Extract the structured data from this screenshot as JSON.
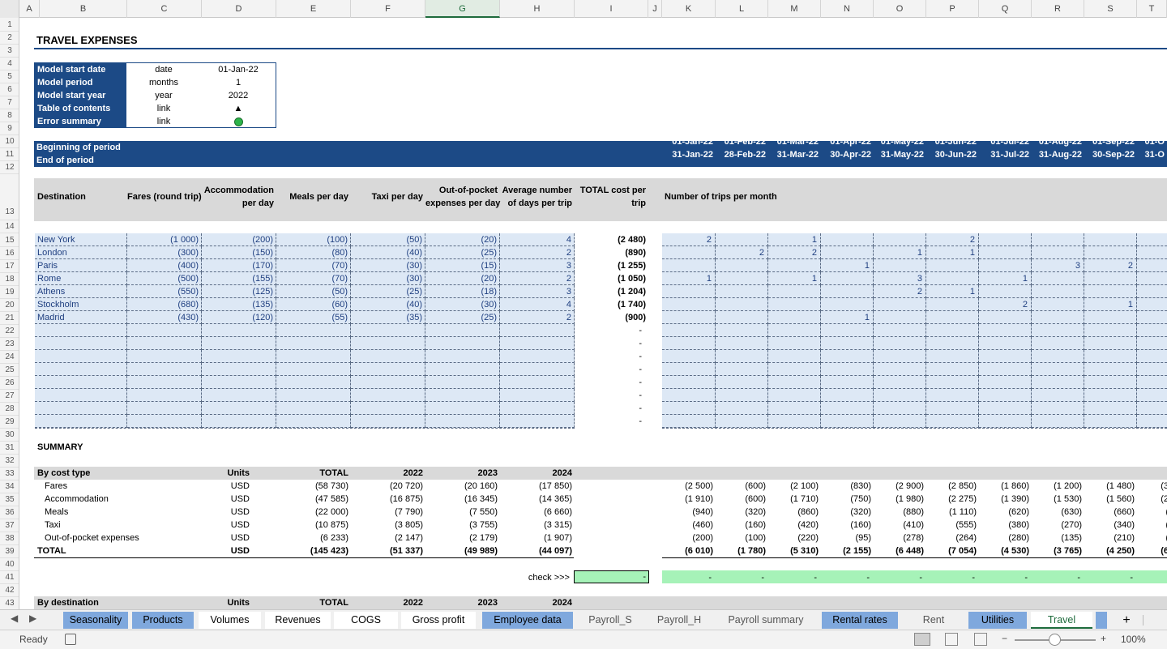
{
  "columns": [
    "A",
    "B",
    "C",
    "D",
    "E",
    "F",
    "G",
    "H",
    "I",
    "J",
    "K",
    "L",
    "M",
    "N",
    "O",
    "P",
    "Q",
    "R",
    "S",
    "T"
  ],
  "selected_column": "G",
  "rows": [
    "1",
    "2",
    "3",
    "4",
    "5",
    "6",
    "7",
    "8",
    "9",
    "10",
    "11",
    "12",
    "13",
    "14",
    "15",
    "16",
    "17",
    "18",
    "19",
    "20",
    "21",
    "22",
    "23",
    "24",
    "25",
    "26",
    "27",
    "28",
    "29",
    "30",
    "31",
    "32",
    "33",
    "34",
    "35",
    "36",
    "37",
    "38",
    "39",
    "40",
    "41",
    "42",
    "43"
  ],
  "title": "TRAVEL EXPENSES",
  "info": [
    {
      "label": "Model start date",
      "unit": "date",
      "value": "01-Jan-22"
    },
    {
      "label": "Model period",
      "unit": "months",
      "value": "1"
    },
    {
      "label": "Model start year",
      "unit": "year",
      "value": "2022"
    },
    {
      "label": "Table of contents",
      "unit": "link",
      "value": "▲"
    },
    {
      "label": "Error summary check",
      "unit": "link",
      "value": "●"
    }
  ],
  "period": {
    "begin_label": "Beginning of period",
    "end_label": "End of period",
    "begin": [
      "01-Jan-22",
      "01-Feb-22",
      "01-Mar-22",
      "01-Apr-22",
      "01-May-22",
      "01-Jun-22",
      "01-Jul-22",
      "01-Aug-22",
      "01-Sep-22",
      "01-O"
    ],
    "end": [
      "31-Jan-22",
      "28-Feb-22",
      "31-Mar-22",
      "30-Apr-22",
      "31-May-22",
      "30-Jun-22",
      "31-Jul-22",
      "31-Aug-22",
      "30-Sep-22",
      "31-O"
    ]
  },
  "table_header": {
    "destination": "Destination",
    "fares": "Fares (round trip)",
    "accom": [
      "Accommodation",
      "per day"
    ],
    "meals": "Meals per day",
    "taxi": "Taxi per day",
    "oop": [
      "Out-of-pocket",
      "expenses per day"
    ],
    "avgdays": [
      "Average number",
      "of days per trip"
    ],
    "total": [
      "TOTAL cost per",
      "trip"
    ],
    "trips": "Number of trips per month"
  },
  "destinations": [
    {
      "name": "New York",
      "vals": [
        "(1 000)",
        "(200)",
        "(100)",
        "(50)",
        "(20)",
        "4"
      ],
      "total": "(2 480)",
      "trips": [
        "2",
        "",
        "1",
        "",
        "",
        "2",
        "",
        "",
        "",
        ""
      ]
    },
    {
      "name": "London",
      "vals": [
        "(300)",
        "(150)",
        "(80)",
        "(40)",
        "(25)",
        "2"
      ],
      "total": "(890)",
      "trips": [
        "",
        "2",
        "2",
        "",
        "1",
        "1",
        "",
        "",
        "",
        ""
      ]
    },
    {
      "name": "Paris",
      "vals": [
        "(400)",
        "(170)",
        "(70)",
        "(30)",
        "(15)",
        "3"
      ],
      "total": "(1 255)",
      "trips": [
        "",
        "",
        "",
        "1",
        "",
        "",
        "",
        "3",
        "2",
        ""
      ]
    },
    {
      "name": "Rome",
      "vals": [
        "(500)",
        "(155)",
        "(70)",
        "(30)",
        "(20)",
        "2"
      ],
      "total": "(1 050)",
      "trips": [
        "1",
        "",
        "1",
        "",
        "3",
        "",
        "1",
        "",
        "",
        ""
      ]
    },
    {
      "name": "Athens",
      "vals": [
        "(550)",
        "(125)",
        "(50)",
        "(25)",
        "(18)",
        "3"
      ],
      "total": "(1 204)",
      "trips": [
        "",
        "",
        "",
        "",
        "2",
        "1",
        "",
        "",
        "",
        ""
      ]
    },
    {
      "name": "Stockholm",
      "vals": [
        "(680)",
        "(135)",
        "(60)",
        "(40)",
        "(30)",
        "4"
      ],
      "total": "(1 740)",
      "trips": [
        "",
        "",
        "",
        "",
        "",
        "",
        "2",
        "",
        "1",
        ""
      ]
    },
    {
      "name": "Madrid",
      "vals": [
        "(430)",
        "(120)",
        "(55)",
        "(35)",
        "(25)",
        "2"
      ],
      "total": "(900)",
      "trips": [
        "",
        "",
        "",
        "1",
        "",
        "",
        "",
        "",
        "",
        ""
      ]
    }
  ],
  "empty_total": "-",
  "summary": {
    "title": "SUMMARY",
    "by_cost_type": "By cost type",
    "units_label": "Units",
    "total_label": "TOTAL",
    "years": [
      "2022",
      "2023",
      "2024"
    ],
    "rows": [
      {
        "label": "Fares",
        "unit": "USD",
        "total": "(58 730)",
        "years": [
          "(20 720)",
          "(20 160)",
          "(17 850)"
        ],
        "months": [
          "(2 500)",
          "(600)",
          "(2 100)",
          "(830)",
          "(2 900)",
          "(2 850)",
          "(1 860)",
          "(1 200)",
          "(1 480)",
          "(3"
        ]
      },
      {
        "label": "Accommodation",
        "unit": "USD",
        "total": "(47 585)",
        "years": [
          "(16 875)",
          "(16 345)",
          "(14 365)"
        ],
        "months": [
          "(1 910)",
          "(600)",
          "(1 710)",
          "(750)",
          "(1 980)",
          "(2 275)",
          "(1 390)",
          "(1 530)",
          "(1 560)",
          "(2"
        ]
      },
      {
        "label": "Meals",
        "unit": "USD",
        "total": "(22 000)",
        "years": [
          "(7 790)",
          "(7 550)",
          "(6 660)"
        ],
        "months": [
          "(940)",
          "(320)",
          "(860)",
          "(320)",
          "(880)",
          "(1 110)",
          "(620)",
          "(630)",
          "(660)",
          "("
        ]
      },
      {
        "label": "Taxi",
        "unit": "USD",
        "total": "(10 875)",
        "years": [
          "(3 805)",
          "(3 755)",
          "(3 315)"
        ],
        "months": [
          "(460)",
          "(160)",
          "(420)",
          "(160)",
          "(410)",
          "(555)",
          "(380)",
          "(270)",
          "(340)",
          "("
        ]
      },
      {
        "label": "Out-of-pocket expenses",
        "unit": "USD",
        "total": "(6 233)",
        "years": [
          "(2 147)",
          "(2 179)",
          "(1 907)"
        ],
        "months": [
          "(200)",
          "(100)",
          "(220)",
          "(95)",
          "(278)",
          "(264)",
          "(280)",
          "(135)",
          "(210)",
          "("
        ]
      }
    ],
    "grand": {
      "label": "TOTAL",
      "unit": "USD",
      "total": "(145 423)",
      "years": [
        "(51 337)",
        "(49 989)",
        "(44 097)"
      ],
      "months": [
        "(6 010)",
        "(1 780)",
        "(5 310)",
        "(2 155)",
        "(6 448)",
        "(7 054)",
        "(4 530)",
        "(3 765)",
        "(4 250)",
        "(6"
      ]
    },
    "check_label": "check >>>",
    "check_value": "-",
    "check_months": [
      "-",
      "-",
      "-",
      "-",
      "-",
      "-",
      "-",
      "-",
      "-"
    ],
    "by_destination": "By destination"
  },
  "tabs": [
    {
      "label": "Seasonality",
      "style": "blue"
    },
    {
      "label": "Products",
      "style": "blue"
    },
    {
      "label": "Volumes",
      "style": "white"
    },
    {
      "label": "Revenues",
      "style": "white"
    },
    {
      "label": "COGS",
      "style": "white"
    },
    {
      "label": "Gross profit",
      "style": "white"
    },
    {
      "label": "Employee data",
      "style": "blue"
    },
    {
      "label": "Payroll_S",
      "style": "grey"
    },
    {
      "label": "Payroll_H",
      "style": "grey"
    },
    {
      "label": "Payroll summary",
      "style": "grey"
    },
    {
      "label": "Rental rates",
      "style": "blue"
    },
    {
      "label": "Rent",
      "style": "grey"
    },
    {
      "label": "Utilities",
      "style": "blue"
    },
    {
      "label": "Travel",
      "style": "active"
    }
  ],
  "add_tab": "+",
  "status": {
    "text": "Ready",
    "zoom": "100%",
    "zoom_minus": "−",
    "zoom_plus": "+"
  }
}
